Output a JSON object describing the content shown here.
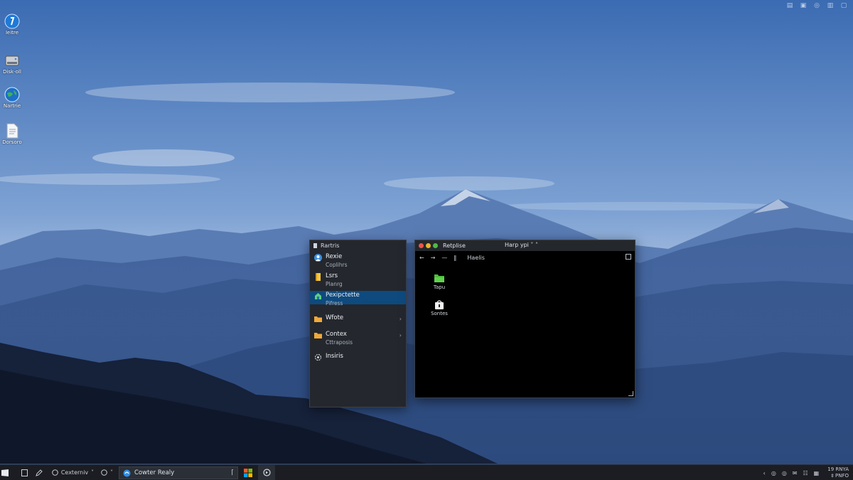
{
  "desktop": {
    "icons": [
      {
        "label": "Ieitre",
        "icon": "help-icon"
      },
      {
        "label": "Disk-oll",
        "icon": "drive-icon"
      },
      {
        "label": "Nartrie",
        "icon": "globe-icon"
      },
      {
        "label": "Dorsoro",
        "icon": "document-icon"
      }
    ]
  },
  "top_tray": [
    "▤",
    "▣",
    "◎",
    "▥",
    "▢"
  ],
  "nav_panel": {
    "title": "Rartris",
    "items": [
      {
        "title": "Rexie",
        "subtitle": "Coplihrs",
        "icon": "user-icon",
        "active": false
      },
      {
        "title": "Lsrs",
        "subtitle": "Planrg",
        "icon": "book-icon",
        "active": false
      },
      {
        "title": "Pexipctette",
        "subtitle": "Pifress",
        "icon": "home-icon",
        "active": true
      },
      {
        "title": "Wfote",
        "subtitle": "",
        "icon": "folder-icon",
        "active": false
      },
      {
        "title": "Contex",
        "subtitle": "Cttraposis",
        "icon": "folder-icon",
        "active": false
      },
      {
        "title": "Insiris",
        "subtitle": "",
        "icon": "settings-icon",
        "active": false
      }
    ]
  },
  "file_window": {
    "title": "Retplise",
    "menu": "Harp ypi ˅ ˄",
    "nav": {
      "back": "←",
      "forward": "→",
      "separator": "—",
      "divider": "‖"
    },
    "breadcrumb": "Haelis",
    "items": [
      {
        "label": "Tapu",
        "icon": "folder-icon",
        "color": "#4bbf3b"
      },
      {
        "label": "Sontes",
        "icon": "bag-icon",
        "color": "#f2f2f2"
      }
    ],
    "traffic_lights": [
      "#e9554a",
      "#e8b52c",
      "#4dbb45"
    ]
  },
  "taskbar": {
    "start": "start-icon",
    "task_view": "task-view-icon",
    "pen": "pen-icon",
    "workspace_label": "Cexterniv",
    "search_value": "Cowter Realy",
    "tray_glyphs": [
      "‹",
      "◎",
      "◎",
      "✉",
      "☷",
      "▦"
    ],
    "clock_time": "19 RNYA",
    "clock_date": "‡ PNFO"
  }
}
